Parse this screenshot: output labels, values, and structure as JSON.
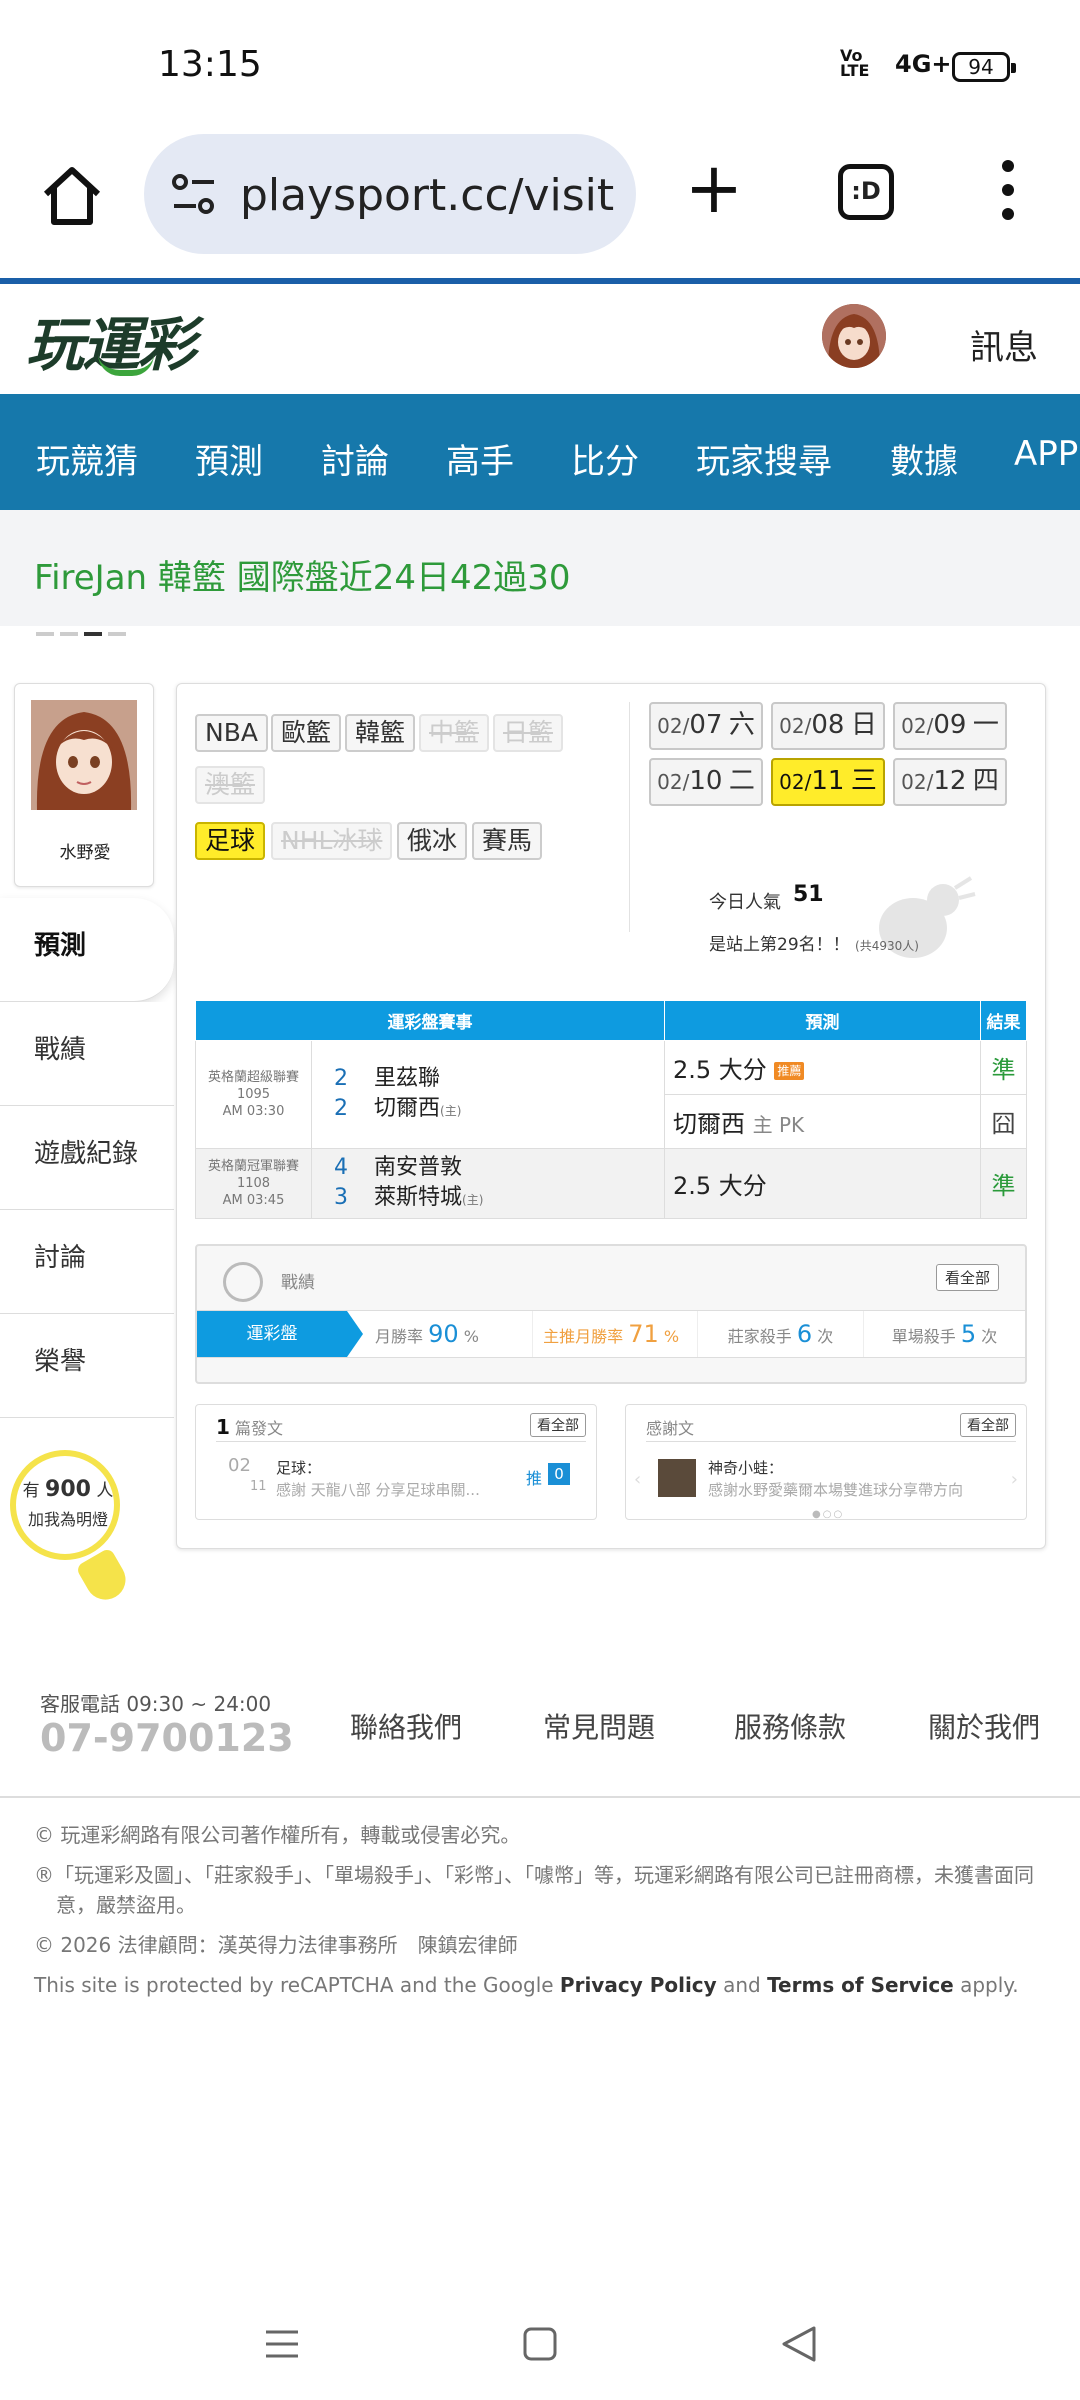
{
  "status": {
    "time": "13:15",
    "signal": "Vo LTE",
    "network": "4G+",
    "battery": "94"
  },
  "browser": {
    "url": "playsport.cc/visit",
    "tabs_label": ":D"
  },
  "site": {
    "logo": "玩運彩",
    "messages": "訊息"
  },
  "nav": [
    "玩競猜",
    "預測",
    "討論",
    "高手",
    "比分",
    "玩家搜尋",
    "數據",
    "APP"
  ],
  "marquee": "FireJan 韓籃 國際盤近24日42過30",
  "profile": {
    "name": "水野愛"
  },
  "side_menu": [
    "預測",
    "戰績",
    "遊戲紀錄",
    "討論",
    "榮譽"
  ],
  "bulb": {
    "prefix": "有",
    "count": "900",
    "suffix": "人",
    "caption": "加我為明燈"
  },
  "sports": [
    "NBA",
    "歐籃",
    "韓籃",
    "中籃",
    "日籃",
    "澳籃",
    "足球",
    "NHL冰球",
    "俄冰",
    "賽馬"
  ],
  "dates": [
    {
      "md": "02/",
      "d": "07",
      "w": "六"
    },
    {
      "md": "02/",
      "d": "08",
      "w": "日"
    },
    {
      "md": "02/",
      "d": "09",
      "w": "一"
    },
    {
      "md": "02/",
      "d": "10",
      "w": "二"
    },
    {
      "md": "02/",
      "d": "11",
      "w": "三"
    },
    {
      "md": "02/",
      "d": "12",
      "w": "四"
    }
  ],
  "popularity": {
    "label": "今日人氣",
    "value": "51",
    "rank": "是站上第29名！！",
    "total": "(共4930人)"
  },
  "table": {
    "headers": [
      "運彩盤賽事",
      "預測",
      "結果"
    ],
    "rows": [
      {
        "league": "英格蘭超級聯賽",
        "code": "1095",
        "time": "AM 03:30",
        "away_num": "2",
        "away": "里茲聯",
        "home_num": "2",
        "home": "切爾西",
        "home_tag": "(主)",
        "preds": [
          {
            "text": "2.5 大分",
            "tag": "推薦",
            "sub": "",
            "result": "準"
          },
          {
            "text": "切爾西",
            "tag": "",
            "sub": "主 PK",
            "result": "囧"
          }
        ]
      },
      {
        "league": "英格蘭冠軍聯賽",
        "code": "1108",
        "time": "AM 03:45",
        "away_num": "4",
        "away": "南安普敦",
        "home_num": "3",
        "home": "萊斯特城",
        "home_tag": "(主)",
        "preds": [
          {
            "text": "2.5 大分",
            "tag": "",
            "sub": "",
            "result": "準"
          }
        ]
      }
    ]
  },
  "stats": {
    "label": "戰績",
    "view_all": "看全部",
    "lead": "運彩盤",
    "items": [
      {
        "label": "月勝率",
        "value": "90",
        "unit": "%",
        "color": "#1a8fd6"
      },
      {
        "label": "主推月勝率",
        "value": "71",
        "unit": "%",
        "color": "#f0a040"
      },
      {
        "label": "莊家殺手",
        "value": "6",
        "unit": "次",
        "color": "#1a8fd6"
      },
      {
        "label": "單場殺手",
        "value": "5",
        "unit": "次",
        "color": "#1a8fd6"
      }
    ]
  },
  "posts": {
    "count": "1",
    "label": "篇發文",
    "view_all": "看全部",
    "day": "02",
    "month": "11",
    "cat": "足球：",
    "title": "感謝 天龍八部 分享足球串關...",
    "push": "推",
    "push_count": "0"
  },
  "thanks": {
    "label": "感謝文",
    "view_all": "看全部",
    "user": "神奇小蛙：",
    "text": "感謝水野愛藥爾本場雙進球分享帶方向"
  },
  "footer": {
    "service_label": "客服電話 09:30 ~ 24:00",
    "phone": "07-9700123",
    "links": [
      "聯絡我們",
      "常見問題",
      "服務條款",
      "關於我們"
    ],
    "copyright": "© 玩運彩網路有限公司著作權所有，轉載或侵害必究。",
    "trademark": "®「玩運彩及圖」、「莊家殺手」、「單場殺手」、「彩幣」、「噱幣」等，玩運彩網路有限公司已註冊商標，未獲書面同意，嚴禁盜用。",
    "legal": "© 2026 法律顧問：漢英得力法律事務所　陳鎮宏律師",
    "recaptcha_pre": "This site is protected by reCAPTCHA and the Google",
    "privacy": "Privacy Policy",
    "and": "and",
    "terms": "Terms of Service",
    "apply": "apply."
  }
}
